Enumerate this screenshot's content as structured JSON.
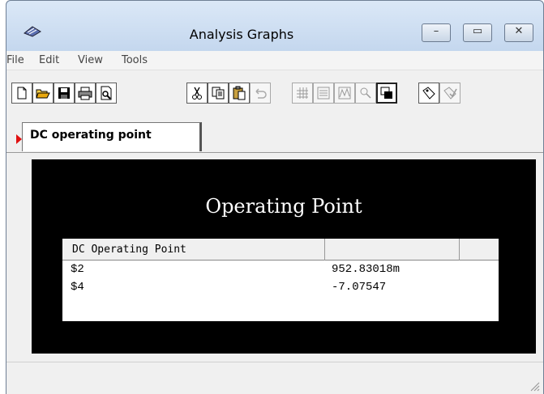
{
  "window": {
    "title": "Analysis Graphs",
    "icon": "app-icon",
    "controls": {
      "minimize": "–",
      "maximize": "▭",
      "close": "✕"
    }
  },
  "menu": [
    "File",
    "Edit",
    "View",
    "Tools"
  ],
  "toolbar": {
    "buttons": [
      {
        "name": "new",
        "icon": "new-file-icon",
        "enabled": true
      },
      {
        "name": "open",
        "icon": "open-folder-icon",
        "enabled": true
      },
      {
        "name": "save",
        "icon": "save-icon",
        "enabled": true
      },
      {
        "name": "print",
        "icon": "print-icon",
        "enabled": true
      },
      {
        "name": "print-preview",
        "icon": "print-preview-icon",
        "enabled": true
      },
      {
        "name": "cut",
        "icon": "cut-icon",
        "enabled": true
      },
      {
        "name": "copy",
        "icon": "copy-icon",
        "enabled": true
      },
      {
        "name": "paste",
        "icon": "paste-icon",
        "enabled": true
      },
      {
        "name": "undo",
        "icon": "undo-icon",
        "enabled": false
      },
      {
        "name": "grid",
        "icon": "grid-icon",
        "enabled": false
      },
      {
        "name": "list",
        "icon": "list-icon",
        "enabled": false
      },
      {
        "name": "waveform",
        "icon": "waveform-icon",
        "enabled": false
      },
      {
        "name": "zoom",
        "icon": "zoom-icon",
        "enabled": false
      },
      {
        "name": "overlay",
        "icon": "overlay-icon",
        "enabled": true,
        "pressed": true
      },
      {
        "name": "tag",
        "icon": "tag-icon",
        "enabled": true
      },
      {
        "name": "tag-check",
        "icon": "tag-check-icon",
        "enabled": false
      }
    ]
  },
  "tab": {
    "label": "DC operating point"
  },
  "plot": {
    "title": "Operating Point",
    "table": {
      "header": "DC Operating Point",
      "rows": [
        {
          "name": "$2",
          "value": "952.83018m"
        },
        {
          "name": "$4",
          "value": "-7.07547"
        }
      ]
    }
  },
  "colors": {
    "plot_background": "#000000",
    "plot_text": "#ffffff",
    "tab_marker": "#e01010"
  }
}
